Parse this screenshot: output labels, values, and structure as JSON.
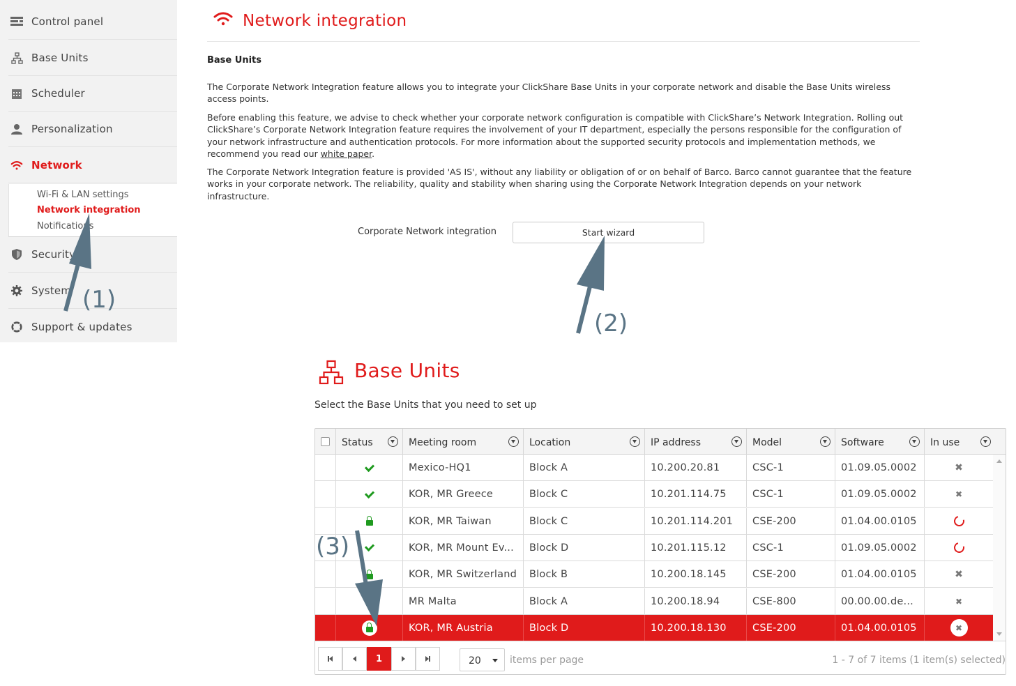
{
  "sidebar": {
    "items": [
      {
        "label": "Control panel",
        "icon": "control-panel-icon"
      },
      {
        "label": "Base Units",
        "icon": "base-units-icon"
      },
      {
        "label": "Scheduler",
        "icon": "calendar-icon"
      },
      {
        "label": "Personalization",
        "icon": "user-icon"
      },
      {
        "label": "Network",
        "icon": "wifi-icon",
        "active": true
      },
      {
        "label": "Security",
        "icon": "shield-icon"
      },
      {
        "label": "System",
        "icon": "gear-icon"
      },
      {
        "label": "Support & updates",
        "icon": "lifebuoy-icon"
      }
    ],
    "submenu": [
      "Wi-Fi & LAN settings",
      "Network integration",
      "Notifications"
    ]
  },
  "network_integration": {
    "title": "Network integration",
    "section_heading": "Base Units",
    "paragraph1": "The Corporate Network Integration feature allows you to integrate your ClickShare Base Units in your corporate network and disable the Base Units wireless access points.",
    "paragraph2_before_link": "Before enabling this feature, we advise to check whether your corporate network configuration is compatible with ClickShare’s Network Integration. Rolling out ClickShare’s Corporate Network Integration feature requires the involvement of your IT department, especially the persons responsible for the configuration of your network infrastructure and authentication protocols. For more information about the supported security protocols and implementation methods, we recommend you read our ",
    "paragraph2_link": "white paper",
    "paragraph2_after_link": ".",
    "paragraph3": "The Corporate Network Integration feature is provided 'AS IS', without any liability or obligation of or on behalf of Barco. Barco cannot guarantee that the feature works in your corporate network. The reliability, quality and stability when sharing using the Corporate Network Integration depends on your network infrastructure.",
    "setting_label": "Corporate Network integration",
    "start_button": "Start wizard"
  },
  "base_units_panel": {
    "title": "Base Units",
    "subtitle": "Select the Base Units that you need to set up",
    "columns": [
      "Status",
      "Meeting room",
      "Location",
      "IP address",
      "Model",
      "Software",
      "In use"
    ],
    "rows": [
      {
        "status": "ok",
        "meeting_room": "Mexico-HQ1",
        "location": "Block A",
        "ip": "10.200.20.81",
        "model": "CSC-1",
        "software": "01.09.05.0002",
        "in_use": "no"
      },
      {
        "status": "ok-circle",
        "meeting_room": "KOR, MR Greece",
        "location": "Block C",
        "ip": "10.201.114.75",
        "model": "CSC-1",
        "software": "01.09.05.0002",
        "in_use": "no-circle"
      },
      {
        "status": "locked",
        "meeting_room": "KOR, MR Taiwan",
        "location": "Block C",
        "ip": "10.201.114.201",
        "model": "CSE-200",
        "software": "01.04.00.0105",
        "in_use": "busy"
      },
      {
        "status": "ok",
        "meeting_room": "KOR, MR Mount Ev...",
        "location": "Block D",
        "ip": "10.201.115.12",
        "model": "CSC-1",
        "software": "01.09.05.0002",
        "in_use": "busy"
      },
      {
        "status": "locked",
        "meeting_room": "KOR, MR Switzerland",
        "location": "Block B",
        "ip": "10.200.18.145",
        "model": "CSE-200",
        "software": "01.04.00.0105",
        "in_use": "no"
      },
      {
        "status": "locked-circle",
        "meeting_room": "MR Malta",
        "location": "Block A",
        "ip": "10.200.18.94",
        "model": "CSE-800",
        "software": "00.00.00.de...",
        "in_use": "no-circle"
      },
      {
        "status": "locked-circle",
        "meeting_room": "KOR, MR Austria",
        "location": "Block D",
        "ip": "10.200.18.130",
        "model": "CSE-200",
        "software": "01.04.00.0105",
        "in_use": "no-circle",
        "selected": true
      }
    ],
    "pager": {
      "current_page": "1",
      "page_size": "20",
      "items_per_page_label": "items per page",
      "info": "1 - 7 of 7 items (1 item(s) selected)"
    }
  },
  "annotations": [
    "(1)",
    "(2)",
    "(3)"
  ],
  "colors": {
    "accent": "#e01b1b",
    "ok": "#1f9a1f",
    "annotation": "#5a7485"
  }
}
